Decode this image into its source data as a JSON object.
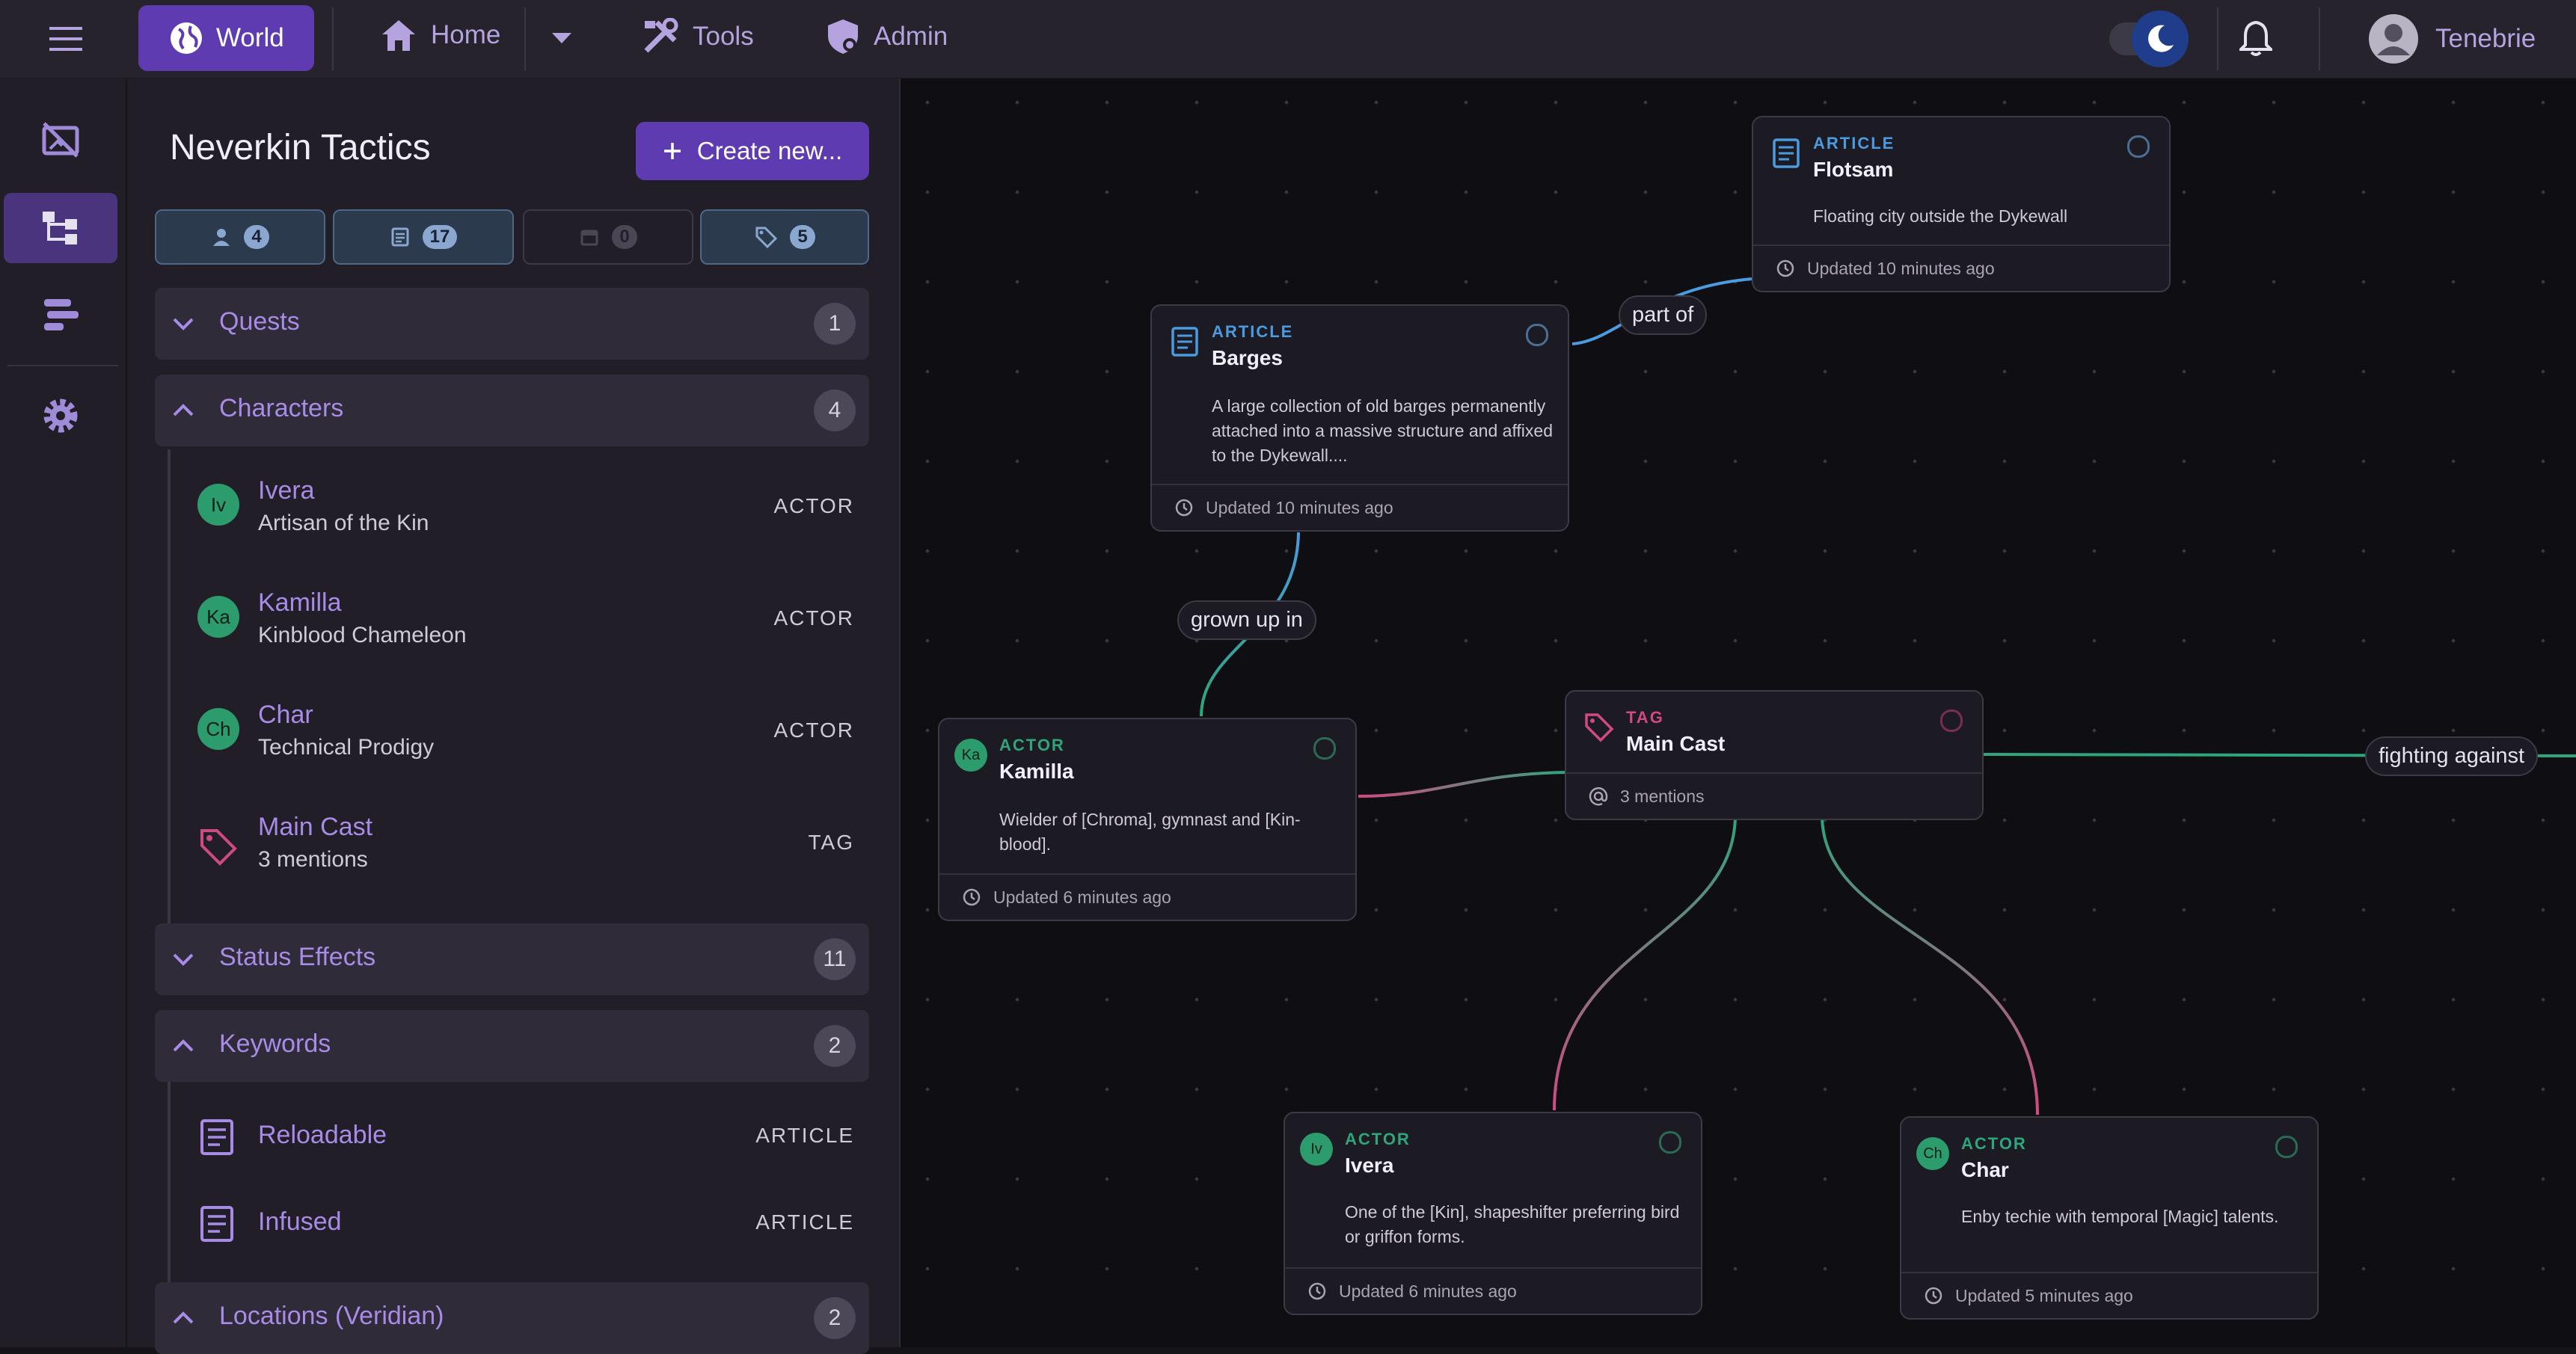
{
  "topbar": {
    "world_label": "World",
    "home_label": "Home",
    "tools_label": "Tools",
    "admin_label": "Admin",
    "username": "Tenebrie"
  },
  "sidebar": {
    "project_title": "Neverkin Tactics",
    "create_label": "Create new...",
    "filters": [
      {
        "icon": "person-icon",
        "count": "4"
      },
      {
        "icon": "article-icon",
        "count": "17"
      },
      {
        "icon": "calendar-icon",
        "count": "0"
      },
      {
        "icon": "tag-icon",
        "count": "5"
      }
    ],
    "sections": {
      "quests": {
        "label": "Quests",
        "count": "1"
      },
      "characters": {
        "label": "Characters",
        "count": "4",
        "items": [
          {
            "initials": "Iv",
            "name": "Ivera",
            "sub": "Artisan of the Kin",
            "type": "ACTOR"
          },
          {
            "initials": "Ka",
            "name": "Kamilla",
            "sub": "Kinblood Chameleon",
            "type": "ACTOR"
          },
          {
            "initials": "Ch",
            "name": "Char",
            "sub": "Technical Prodigy",
            "type": "ACTOR"
          },
          {
            "name": "Main Cast",
            "sub": "3 mentions",
            "type": "TAG"
          }
        ]
      },
      "status_effects": {
        "label": "Status Effects",
        "count": "11"
      },
      "keywords": {
        "label": "Keywords",
        "count": "2",
        "items": [
          {
            "name": "Reloadable",
            "type": "ARTICLE"
          },
          {
            "name": "Infused",
            "type": "ARTICLE"
          }
        ]
      },
      "locations": {
        "label": "Locations (Veridian)",
        "count": "2"
      }
    }
  },
  "canvas": {
    "nodes": {
      "flotsam": {
        "type": "ARTICLE",
        "title": "Flotsam",
        "desc": "Floating city outside the Dykewall",
        "updated": "Updated 10 minutes ago"
      },
      "barges": {
        "type": "ARTICLE",
        "title": "Barges",
        "desc": "A large collection of old barges permanently attached into a massive structure and affixed to the Dykewall....",
        "updated": "Updated 10 minutes ago"
      },
      "kamilla": {
        "type": "ACTOR",
        "initials": "Ka",
        "title": "Kamilla",
        "desc": "Wielder of [Chroma], gymnast and [Kin-blood].",
        "updated": "Updated 6 minutes ago"
      },
      "maincast": {
        "type": "TAG",
        "title": "Main Cast",
        "mentions": "3 mentions"
      },
      "ivera": {
        "type": "ACTOR",
        "initials": "Iv",
        "title": "Ivera",
        "desc": "One of the [Kin], shapeshifter preferring bird or griffon forms.",
        "updated": "Updated 6 minutes ago"
      },
      "char": {
        "type": "ACTOR",
        "initials": "Ch",
        "title": "Char",
        "desc": "Enby techie with temporal [Magic] talents.",
        "updated": "Updated 5 minutes ago"
      }
    },
    "edges": {
      "part_of": "part of",
      "grown_up_in": "grown up in",
      "fighting_against": "fighting against"
    }
  },
  "colors": {
    "accent": "#5e3bb1",
    "accent_text": "#a78be6",
    "article": "#4a9be0",
    "actor": "#2ea57a",
    "tag": "#d04a82"
  }
}
